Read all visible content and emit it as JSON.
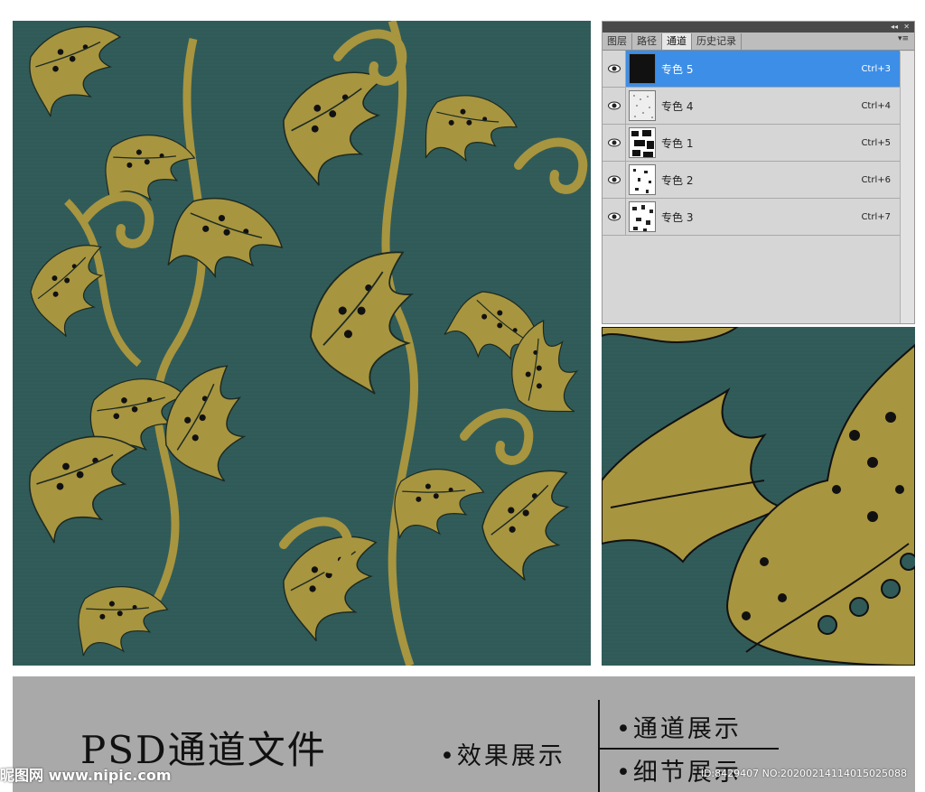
{
  "panel": {
    "tabs": [
      {
        "label": "图层"
      },
      {
        "label": "路径"
      },
      {
        "label": "通道"
      },
      {
        "label": "历史记录"
      }
    ],
    "channels": [
      {
        "name": "专色 5",
        "shortcut": "Ctrl+3",
        "selected": true
      },
      {
        "name": "专色 4",
        "shortcut": "Ctrl+4",
        "selected": false
      },
      {
        "name": "专色 1",
        "shortcut": "Ctrl+5",
        "selected": false
      },
      {
        "name": "专色 2",
        "shortcut": "Ctrl+6",
        "selected": false
      },
      {
        "name": "专色 3",
        "shortcut": "Ctrl+7",
        "selected": false
      }
    ]
  },
  "banner": {
    "title": "PSD通道文件",
    "items": [
      "•效果展示",
      "•通道展示",
      "•细节展示"
    ]
  },
  "watermark": {
    "left": "昵图网 www.nipic.com",
    "right": "ID:8429407 NO:20200214114015025088"
  },
  "colors": {
    "background": "#2f5a58",
    "motif": "#a8953f",
    "selection": "#3d8ee6"
  }
}
